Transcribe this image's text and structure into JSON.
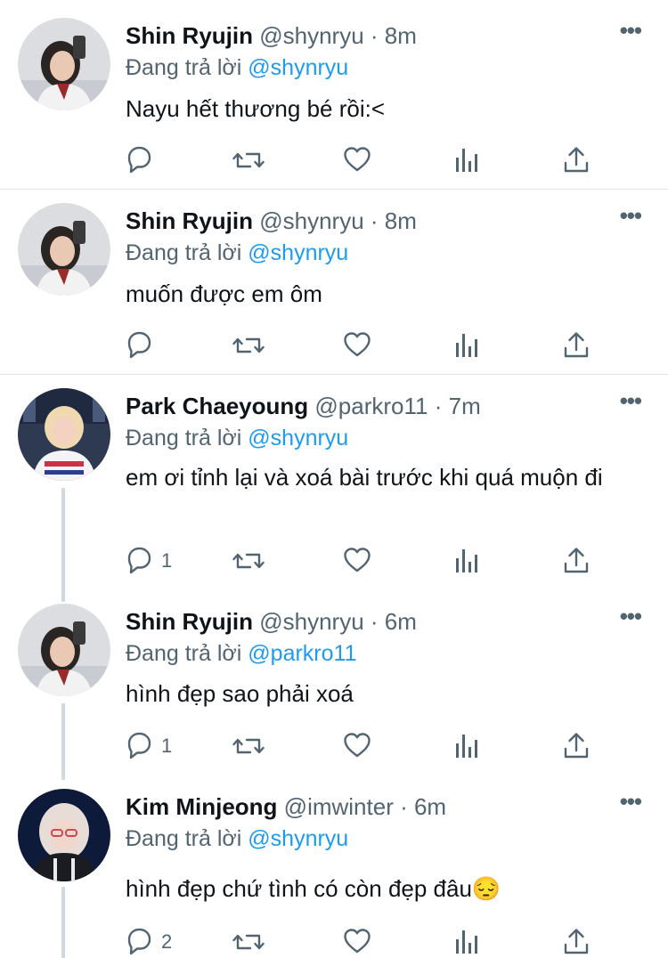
{
  "colors": {
    "accent": "#1d9bf0",
    "muted": "#536471",
    "text": "#0f1419",
    "divider": "#dfe3e6"
  },
  "tweets": [
    {
      "name": "Shin Ryujin",
      "handle": "@shynryu",
      "time": "· 8m",
      "reply_prefix": "Đang trả lời",
      "reply_to": "@shynryu",
      "text": "Nayu hết thương bé rồi:<",
      "replies": "",
      "avatar": "ryujin-avatar"
    },
    {
      "name": "Shin Ryujin",
      "handle": "@shynryu",
      "time": "· 8m",
      "reply_prefix": "Đang trả lời",
      "reply_to": "@shynryu",
      "text": "muốn được em ôm",
      "replies": "",
      "avatar": "ryujin-avatar"
    },
    {
      "name": "Park Chaeyoung",
      "handle": "@parkro11",
      "time": "· 7m",
      "reply_prefix": "Đang trả lời",
      "reply_to": "@shynryu",
      "text": "em ơi tỉnh lại và xoá bài trước khi quá muộn đi",
      "replies": "1",
      "avatar": "chaeyoung-avatar"
    },
    {
      "name": "Shin Ryujin",
      "handle": "@shynryu",
      "time": "· 6m",
      "reply_prefix": "Đang trả lời",
      "reply_to": "@parkro11",
      "text": "hình đẹp sao phải xoá",
      "replies": "1",
      "avatar": "ryujin-avatar"
    },
    {
      "name": "Kim Minjeong",
      "handle": "@imwinter",
      "time": "· 6m",
      "reply_prefix": "Đang trả lời",
      "reply_to": "@shynryu",
      "text": "hình đẹp chứ tình có còn đẹp đâu😔",
      "replies": "2",
      "avatar": "minjeong-avatar"
    }
  ],
  "icons": [
    "reply-icon",
    "retweet-icon",
    "like-icon",
    "analytics-icon",
    "share-icon",
    "more-icon"
  ]
}
